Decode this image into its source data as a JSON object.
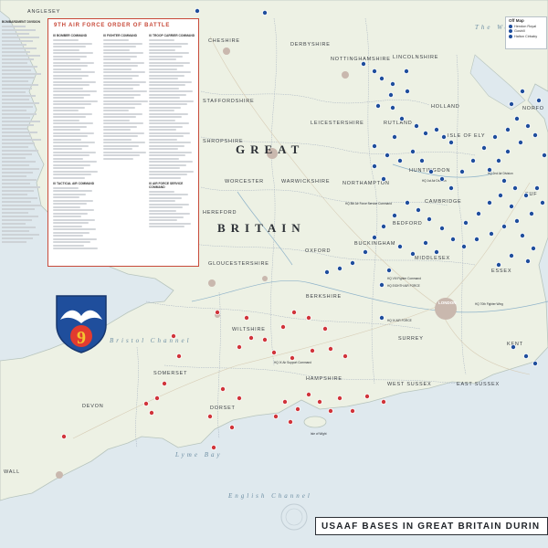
{
  "oob": {
    "title": "9TH AIR FORCE ORDER OF BATTLE",
    "col1_head": "IX BOMBER COMMAND",
    "col2_head": "IX FIGHTER COMMAND",
    "col3_head": "IX TROOP CARRIER COMMAND",
    "col1b_head": "IX TACTICAL AIR COMMAND",
    "col3b_head": "IX AIR FORCE SERVICE COMMAND"
  },
  "left_strip": {
    "head": "BOMBARDMENT DIVISION"
  },
  "legend": {
    "title": "Off Map",
    "items": [
      "Hendon Royal",
      "Goshill",
      "Halton Cirbaby"
    ]
  },
  "title": "USAAF BASES IN GREAT BRITAIN DURIN",
  "emblem_text": "9",
  "labels": {
    "anglesey": "ANGLESEY",
    "great": "GREAT",
    "britain": "BRITAIN",
    "cheshire": "CHESHIRE",
    "derbyshire": "DERBYSHIRE",
    "nottinghamshire": "NOTTINGHAMSHIRE",
    "lincolnshire": "LINCOLNSHIRE",
    "staffordshire": "STAFFORDSHIRE",
    "holland": "HOLLAND",
    "norfolk": "NORFO",
    "shropshire": "SHROPSHIRE",
    "leicestershire": "LEICESTERSHIRE",
    "rutland": "RUTLAND",
    "isle_of_ely": "ISLE OF ELY",
    "worcester": "WORCESTER",
    "warwickshire": "WARWICKSHIRE",
    "northampton": "NORTHAMPTON",
    "huntingdon": "HUNTINGDON",
    "suffolk": "SUF",
    "hereford": "HEREFORD",
    "cambridge": "CAMBRIDGE",
    "bedford": "BEDFORD",
    "oxford": "OXFORD",
    "buckingham": "BUCKINGHAM",
    "middlesex": "MIDDLESEX",
    "essex": "ESSEX",
    "gloucestershire": "GLOUCESTERSHIRE",
    "berkshire": "BERKSHIRE",
    "london": "LONDON",
    "wiltshire": "WILTSHIRE",
    "surrey": "SURREY",
    "kent": "KENT",
    "somerset": "SOMERSET",
    "hampshire": "HAMPSHIRE",
    "west_sussex": "WEST SUSSEX",
    "east_sussex": "EAST SUSSEX",
    "devon": "DEVON",
    "dorset": "DORSET",
    "cornwall": "WALL",
    "isle_of_wight": "Isle of Wight",
    "irish_sea": "The Wash",
    "bristol_channel": "Bristol Channel",
    "english_channel": "English Channel",
    "lyme_bay": "Lyme Bay"
  },
  "hq": [
    "HQ 2nd Air Division",
    "HQ 1st Air Division",
    "HQ 8th Air Force Service Command",
    "HQ VIII Fighter Command",
    "HQ EIGHTH AIR FORCE",
    "HQ IX AIR FORCE",
    "HQ IX Air Support Command",
    "HQ 70th Fighter Wing"
  ],
  "colors": {
    "land": "#edf1e4",
    "sea": "#dfe9ee",
    "eighth_af": "#1f4e9c",
    "ninth_af": "#d0343a",
    "accent": "#c84a3a"
  }
}
